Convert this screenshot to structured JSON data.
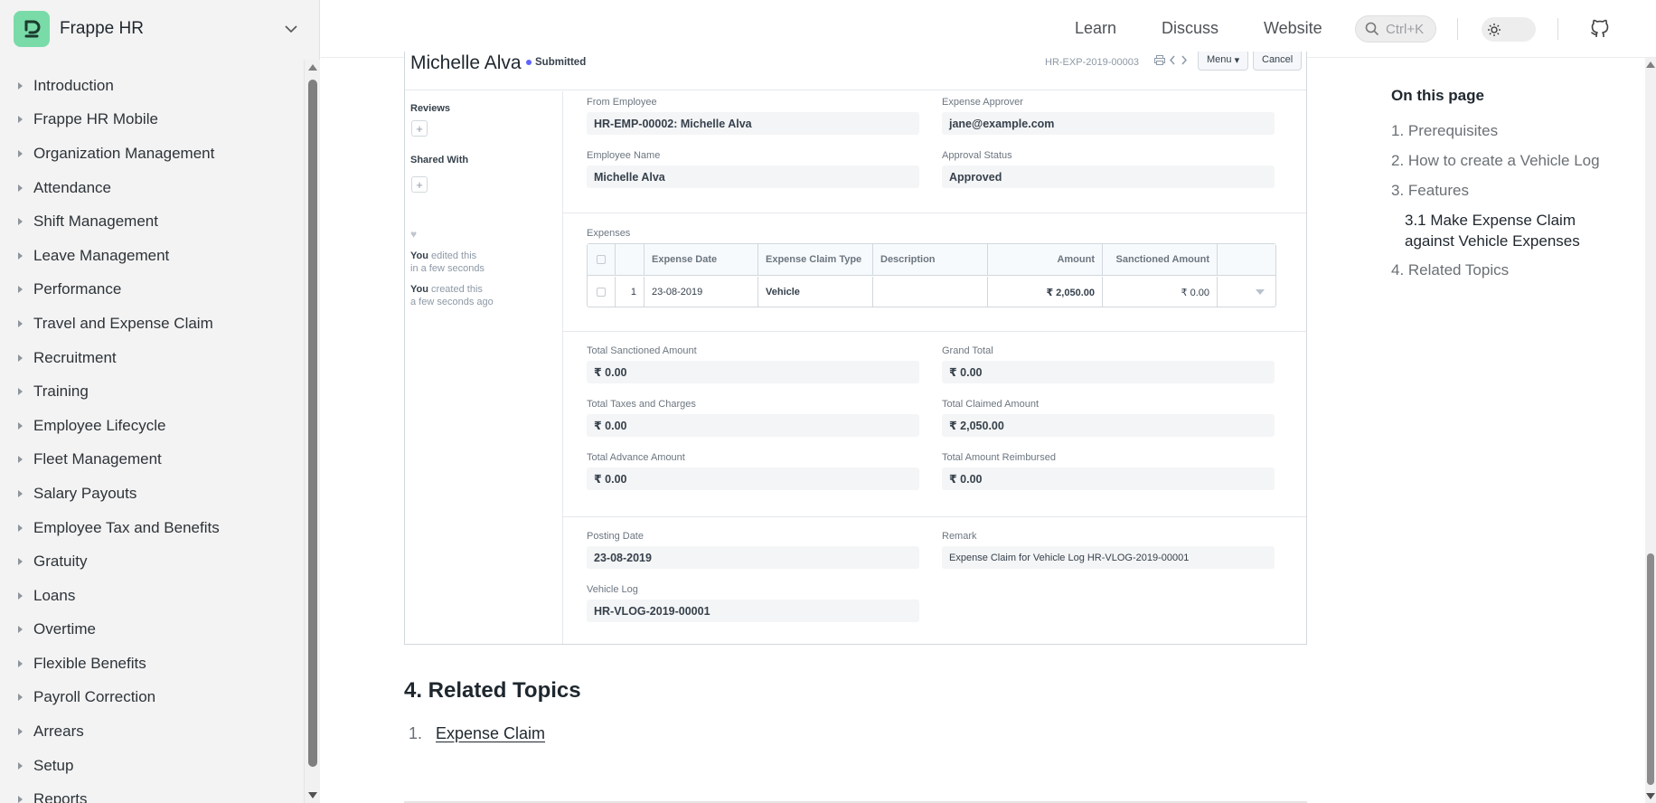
{
  "brand": {
    "name": "Frappe HR"
  },
  "sidebar": {
    "items": [
      "Introduction",
      "Frappe HR Mobile",
      "Organization Management",
      "Attendance",
      "Shift Management",
      "Leave Management",
      "Performance",
      "Travel and Expense Claim",
      "Recruitment",
      "Training",
      "Employee Lifecycle",
      "Fleet Management",
      "Salary Payouts",
      "Employee Tax and Benefits",
      "Gratuity",
      "Loans",
      "Overtime",
      "Flexible Benefits",
      "Payroll Correction",
      "Arrears",
      "Setup",
      "Reports"
    ]
  },
  "topbar": {
    "learn": "Learn",
    "discuss": "Discuss",
    "website": "Website",
    "search_placeholder": "Ctrl+K"
  },
  "doc": {
    "title": "Michelle Alva",
    "status": "Submitted",
    "doc_id": "HR-EXP-2019-00003",
    "menu_label": "Menu",
    "cancel_label": "Cancel",
    "side": {
      "reviews": "Reviews",
      "shared_with": "Shared With",
      "you": "You",
      "edited_line1": "edited this",
      "edited_line2": "in a few seconds",
      "created_line1": "created this",
      "created_line2": "a few seconds ago"
    },
    "fields": {
      "from_employee_label": "From Employee",
      "from_employee": "HR-EMP-00002: Michelle Alva",
      "approver_label": "Expense Approver",
      "approver": "jane@example.com",
      "employee_name_label": "Employee Name",
      "employee_name": "Michelle Alva",
      "approval_status_label": "Approval Status",
      "approval_status": "Approved",
      "expenses_label": "Expenses",
      "total_sanctioned_label": "Total Sanctioned Amount",
      "total_sanctioned": "₹ 0.00",
      "grand_total_label": "Grand Total",
      "grand_total": "₹ 0.00",
      "total_taxes_label": "Total Taxes and Charges",
      "total_taxes": "₹ 0.00",
      "total_claimed_label": "Total Claimed Amount",
      "total_claimed": "₹ 2,050.00",
      "total_advance_label": "Total Advance Amount",
      "total_advance": "₹ 0.00",
      "total_reimbursed_label": "Total Amount Reimbursed",
      "total_reimbursed": "₹ 0.00",
      "posting_date_label": "Posting Date",
      "posting_date": "23-08-2019",
      "remark_label": "Remark",
      "remark": "Expense Claim for Vehicle Log HR-VLOG-2019-00001",
      "vehicle_log_label": "Vehicle Log",
      "vehicle_log": "HR-VLOG-2019-00001"
    },
    "table": {
      "headers": {
        "expense_date": "Expense Date",
        "claim_type": "Expense Claim Type",
        "description": "Description",
        "amount": "Amount",
        "sanctioned": "Sanctioned Amount"
      },
      "row": {
        "idx": "1",
        "expense_date": "23-08-2019",
        "claim_type": "Vehicle",
        "description": "",
        "amount": "₹ 2,050.00",
        "sanctioned": "₹ 0.00"
      }
    }
  },
  "related": {
    "heading": "4. Related Topics",
    "item_num": "1.",
    "item_link": "Expense Claim"
  },
  "toc": {
    "title": "On this page",
    "items": [
      "1. Prerequisites",
      "2. How to create a Vehicle Log",
      "3. Features",
      "3.1 Make Expense Claim against Vehicle Expenses",
      "4. Related Topics"
    ]
  }
}
